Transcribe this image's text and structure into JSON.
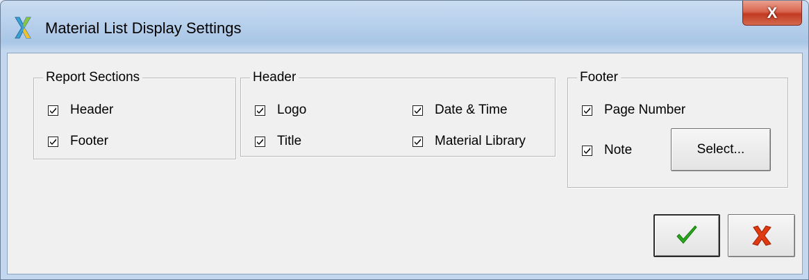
{
  "window": {
    "title": "Material List Display Settings",
    "app_icon": "app-logo-icon",
    "close_glyph": "X"
  },
  "report_sections": {
    "legend": "Report Sections",
    "items": [
      {
        "label": "Header",
        "checked": true
      },
      {
        "label": "Footer",
        "checked": true
      }
    ]
  },
  "header_group": {
    "legend": "Header",
    "items": [
      {
        "label": "Logo",
        "checked": true
      },
      {
        "label": "Title",
        "checked": true
      },
      {
        "label": "Date & Time",
        "checked": true
      },
      {
        "label": "Material Library",
        "checked": true
      }
    ]
  },
  "footer_group": {
    "legend": "Footer",
    "items": [
      {
        "label": "Page Number",
        "checked": true
      },
      {
        "label": "Note",
        "checked": true
      }
    ],
    "select_label": "Select..."
  },
  "actions": {
    "ok_icon": "checkmark-icon",
    "cancel_icon": "red-x-icon",
    "ok_color": "#2aa81e",
    "cancel_color": "#e03a10"
  }
}
